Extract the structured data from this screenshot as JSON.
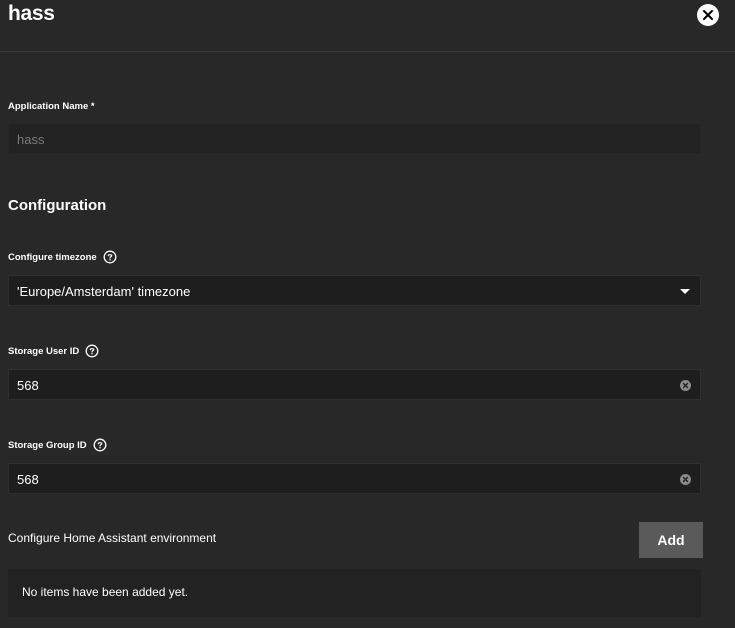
{
  "header": {
    "title": "hass",
    "close_icon": "close-icon"
  },
  "app_name": {
    "label": "Application Name *",
    "value": "hass"
  },
  "configuration": {
    "heading": "Configuration",
    "timezone": {
      "label": "Configure timezone",
      "value": "'Europe/Amsterdam' timezone"
    },
    "storage_user_id": {
      "label": "Storage User ID",
      "value": "568"
    },
    "storage_group_id": {
      "label": "Storage Group ID",
      "value": "568"
    }
  },
  "environment": {
    "label": "Configure Home Assistant environment",
    "add_label": "Add",
    "empty_text": "No items have been added yet."
  },
  "colors": {
    "background": "#282828",
    "input_background": "#1e1e1e",
    "add_button": "#5a5a5a"
  }
}
